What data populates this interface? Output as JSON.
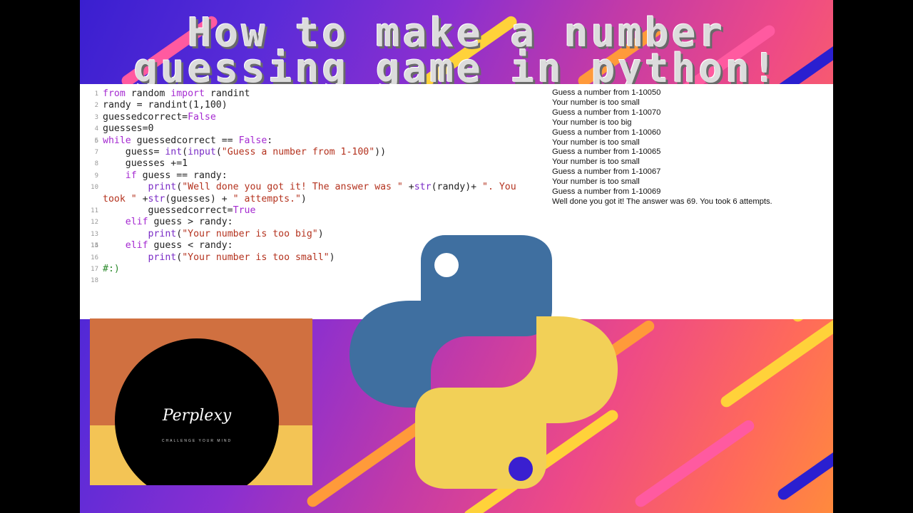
{
  "title": {
    "line1": "How to make a number",
    "line2": "guessing game in python!"
  },
  "code": {
    "lines": [
      {
        "n": "1",
        "html": "<span class=\"kw\">from</span> random <span class=\"kw\">import</span> randint"
      },
      {
        "n": "2",
        "html": "randy = randint(1,100)"
      },
      {
        "n": "3",
        "html": "guessedcorrect=<span class=\"kw\">False</span>"
      },
      {
        "n": "4",
        "html": "guesses=0"
      },
      {
        "n": "5",
        "html": ""
      },
      {
        "n": "6",
        "html": "<span class=\"kw\">while</span> guessedcorrect == <span class=\"kw\">False</span>:"
      },
      {
        "n": "7",
        "html": "    guess= <span class=\"bi\">int</span>(<span class=\"bi\">input</span>(<span class=\"str\">\"Guess a number from 1-100\"</span>))"
      },
      {
        "n": "8",
        "html": "    guesses +=1"
      },
      {
        "n": "9",
        "html": "    <span class=\"kw\">if</span> guess == randy:"
      },
      {
        "n": "10",
        "wrap": true,
        "html": "        <span class=\"bi\">print</span>(<span class=\"str\">\"Well done you got it! The answer was \"</span> +<span class=\"bi\">str</span>(randy)+ <span class=\"str\">\". You</span>\n<span class=\"str\">took \"</span> +<span class=\"bi\">str</span>(guesses) + <span class=\"str\">\" attempts.\"</span>)"
      },
      {
        "n": "11",
        "html": "        guessedcorrect=<span class=\"kw\">True</span>"
      },
      {
        "n": "12",
        "html": "    <span class=\"kw\">elif</span> guess &gt; randy:"
      },
      {
        "n": "13",
        "html": "        <span class=\"bi\">print</span>(<span class=\"str\">\"Your number is too big\"</span>)"
      },
      {
        "n": "14",
        "html": ""
      },
      {
        "n": "15",
        "html": "    <span class=\"kw\">elif</span> guess &lt; randy:"
      },
      {
        "n": "16",
        "html": "        <span class=\"bi\">print</span>(<span class=\"str\">\"Your number is too small\"</span>)"
      },
      {
        "n": "17",
        "html": "<span class=\"cm\">#:)</span>"
      },
      {
        "n": "18",
        "html": ""
      }
    ]
  },
  "output": {
    "lines": [
      "Guess a number from 1-10050",
      "Your number is too small",
      "Guess a number from 1-10070",
      "Your number is too big",
      "Guess a number from 1-10060",
      "Your number is too small",
      "Guess a number from 1-10065",
      "Your number is too small",
      "Guess a number from 1-10067",
      "Your number is too small",
      "Guess a number from 1-10069",
      "Well done you got it! The answer was 69. You took 6 attempts."
    ]
  },
  "logo": {
    "wordmark": "Perplexy",
    "tagline": "CHALLENGE YOUR MIND"
  },
  "colors": {
    "python_blue": "#3f6fa0",
    "python_yellow": "#f2d057",
    "logo_orange": "#d07040",
    "logo_yellow": "#f3c455"
  },
  "icons": {
    "python": "python-logo-icon"
  }
}
